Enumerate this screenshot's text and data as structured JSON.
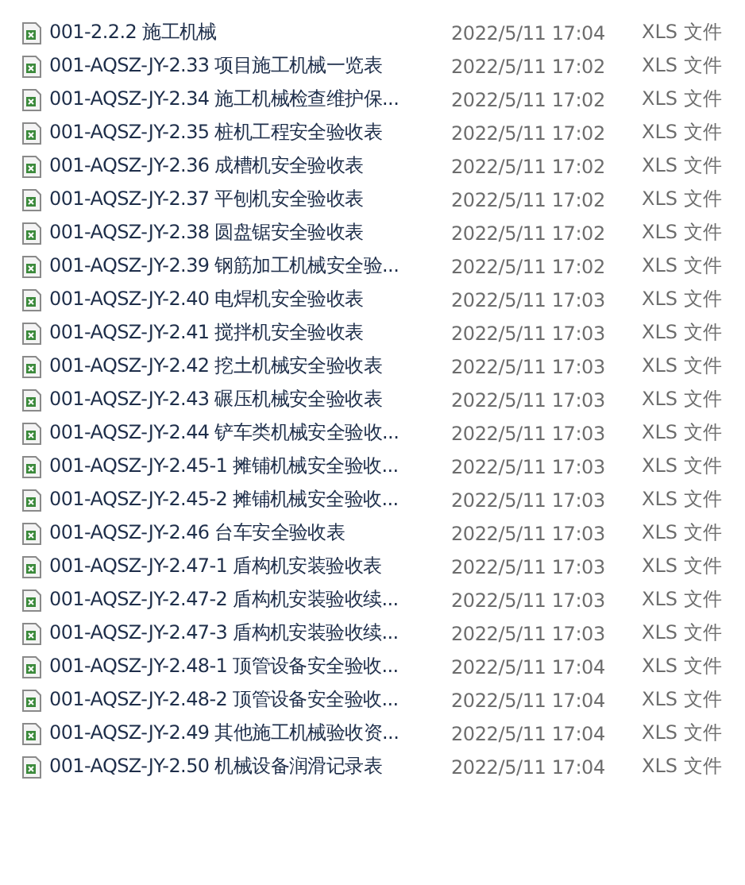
{
  "files": [
    {
      "name": "001-2.2.2 施工机械",
      "modified": "2022/5/11 17:04",
      "type": "XLS 文件"
    },
    {
      "name": "001-AQSZ-JY-2.33 项目施工机械一览表",
      "modified": "2022/5/11 17:02",
      "type": "XLS 文件"
    },
    {
      "name": "001-AQSZ-JY-2.34 施工机械检查维护保...",
      "modified": "2022/5/11 17:02",
      "type": "XLS 文件"
    },
    {
      "name": "001-AQSZ-JY-2.35 桩机工程安全验收表",
      "modified": "2022/5/11 17:02",
      "type": "XLS 文件"
    },
    {
      "name": "001-AQSZ-JY-2.36 成槽机安全验收表",
      "modified": "2022/5/11 17:02",
      "type": "XLS 文件"
    },
    {
      "name": "001-AQSZ-JY-2.37 平刨机安全验收表",
      "modified": "2022/5/11 17:02",
      "type": "XLS 文件"
    },
    {
      "name": "001-AQSZ-JY-2.38 圆盘锯安全验收表",
      "modified": "2022/5/11 17:02",
      "type": "XLS 文件"
    },
    {
      "name": "001-AQSZ-JY-2.39 钢筋加工机械安全验...",
      "modified": "2022/5/11 17:02",
      "type": "XLS 文件"
    },
    {
      "name": "001-AQSZ-JY-2.40 电焊机安全验收表",
      "modified": "2022/5/11 17:03",
      "type": "XLS 文件"
    },
    {
      "name": "001-AQSZ-JY-2.41 搅拌机安全验收表",
      "modified": "2022/5/11 17:03",
      "type": "XLS 文件"
    },
    {
      "name": "001-AQSZ-JY-2.42 挖土机械安全验收表",
      "modified": "2022/5/11 17:03",
      "type": "XLS 文件"
    },
    {
      "name": "001-AQSZ-JY-2.43 碾压机械安全验收表",
      "modified": "2022/5/11 17:03",
      "type": "XLS 文件"
    },
    {
      "name": "001-AQSZ-JY-2.44 铲车类机械安全验收...",
      "modified": "2022/5/11 17:03",
      "type": "XLS 文件"
    },
    {
      "name": "001-AQSZ-JY-2.45-1 摊铺机械安全验收...",
      "modified": "2022/5/11 17:03",
      "type": "XLS 文件"
    },
    {
      "name": "001-AQSZ-JY-2.45-2 摊铺机械安全验收...",
      "modified": "2022/5/11 17:03",
      "type": "XLS 文件"
    },
    {
      "name": "001-AQSZ-JY-2.46 台车安全验收表",
      "modified": "2022/5/11 17:03",
      "type": "XLS 文件"
    },
    {
      "name": "001-AQSZ-JY-2.47-1 盾构机安装验收表",
      "modified": "2022/5/11 17:03",
      "type": "XLS 文件"
    },
    {
      "name": "001-AQSZ-JY-2.47-2 盾构机安装验收续...",
      "modified": "2022/5/11 17:03",
      "type": "XLS 文件"
    },
    {
      "name": "001-AQSZ-JY-2.47-3 盾构机安装验收续...",
      "modified": "2022/5/11 17:03",
      "type": "XLS 文件"
    },
    {
      "name": "001-AQSZ-JY-2.48-1 顶管设备安全验收...",
      "modified": "2022/5/11 17:04",
      "type": "XLS 文件"
    },
    {
      "name": "001-AQSZ-JY-2.48-2 顶管设备安全验收...",
      "modified": "2022/5/11 17:04",
      "type": "XLS 文件"
    },
    {
      "name": "001-AQSZ-JY-2.49 其他施工机械验收资...",
      "modified": "2022/5/11 17:04",
      "type": "XLS 文件"
    },
    {
      "name": "001-AQSZ-JY-2.50 机械设备润滑记录表",
      "modified": "2022/5/11 17:04",
      "type": "XLS 文件"
    }
  ]
}
